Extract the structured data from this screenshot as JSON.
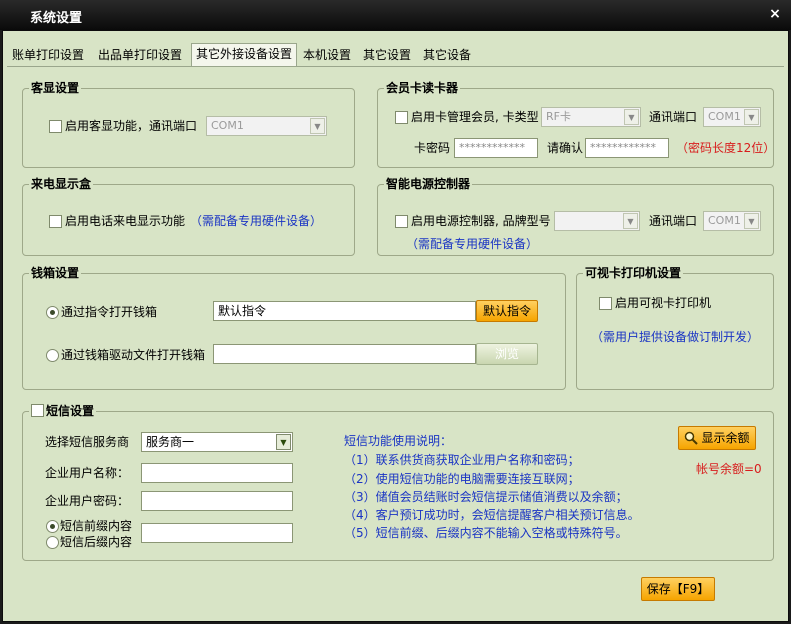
{
  "window": {
    "title": "系统设置",
    "close_glyph": "×"
  },
  "tabs": [
    {
      "label": "账单打印设置"
    },
    {
      "label": "出品单打印设置"
    },
    {
      "label": "其它外接设备设置"
    },
    {
      "label": "本机设置"
    },
    {
      "label": "其它设置"
    },
    {
      "label": "其它设备"
    }
  ],
  "active_tab": "其它外接设备设置",
  "customer_display": {
    "title": "客显设置",
    "enable_label": "启用客显功能，通讯端口",
    "enabled": false,
    "port": "COM1"
  },
  "card_reader": {
    "title": "会员卡读卡器",
    "enable_label": "启用卡管理会员, 卡类型",
    "enabled": false,
    "card_type": "RF卡",
    "port_label": "通讯端口",
    "port": "COM1",
    "password_label": "卡密码",
    "password_value": "************",
    "confirm_label": "请确认",
    "confirm_value": "************",
    "hint": "（密码长度12位）"
  },
  "caller_id": {
    "title": "来电显示盒",
    "enable_label": "启用电话来电显示功能",
    "enabled": false,
    "hint": "（需配备专用硬件设备）"
  },
  "power_controller": {
    "title": "智能电源控制器",
    "enable_label": "启用电源控制器, 品牌型号",
    "enabled": false,
    "brand": "",
    "port_label": "通讯端口",
    "port": "COM1",
    "hint": "（需配备专用硬件设备）"
  },
  "cash_drawer": {
    "title": "钱箱设置",
    "option1_label": "通过指令打开钱箱",
    "option1_selected": true,
    "command_value": "默认指令",
    "default_cmd_button": "默认指令",
    "option2_label": "通过钱箱驱动文件打开钱箱",
    "option2_selected": false,
    "driver_path": "",
    "browse_button": "浏览"
  },
  "card_printer": {
    "title": "可视卡打印机设置",
    "enable_label": "启用可视卡打印机",
    "enabled": false,
    "hint": "（需用户提供设备做订制开发）"
  },
  "sms": {
    "title": "短信设置",
    "enabled": false,
    "provider_label": "选择短信服务商",
    "provider_value": "服务商一",
    "user_label": "企业用户名称：",
    "user_value": "",
    "password_label": "企业用户密码：",
    "password_value": "",
    "prefix_label": "短信前缀内容",
    "prefix_selected": true,
    "suffix_label": "短信后缀内容",
    "suffix_selected": false,
    "affix_value": "",
    "instructions_title": "短信功能使用说明：",
    "instructions": [
      "（1）联系供货商获取企业用户名称和密码；",
      "（2）使用短信功能的电脑需要连接互联网；",
      "（3）储值会员结账时会短信提示储值消费以及余额；",
      "（4）客户预订成功时，会短信提醒客户相关预订信息。",
      "（5）短信前缀、后缀内容不能输入空格或特殊符号。"
    ],
    "show_balance_button": "显示余额",
    "balance_text": "帐号余额=0"
  },
  "save_button": "保存【F9】",
  "colors": {
    "background": "#d8e4c6",
    "accent_orange": "#f6a400",
    "hint_blue": "#1a34c4",
    "warning_red": "#d81c1c"
  }
}
